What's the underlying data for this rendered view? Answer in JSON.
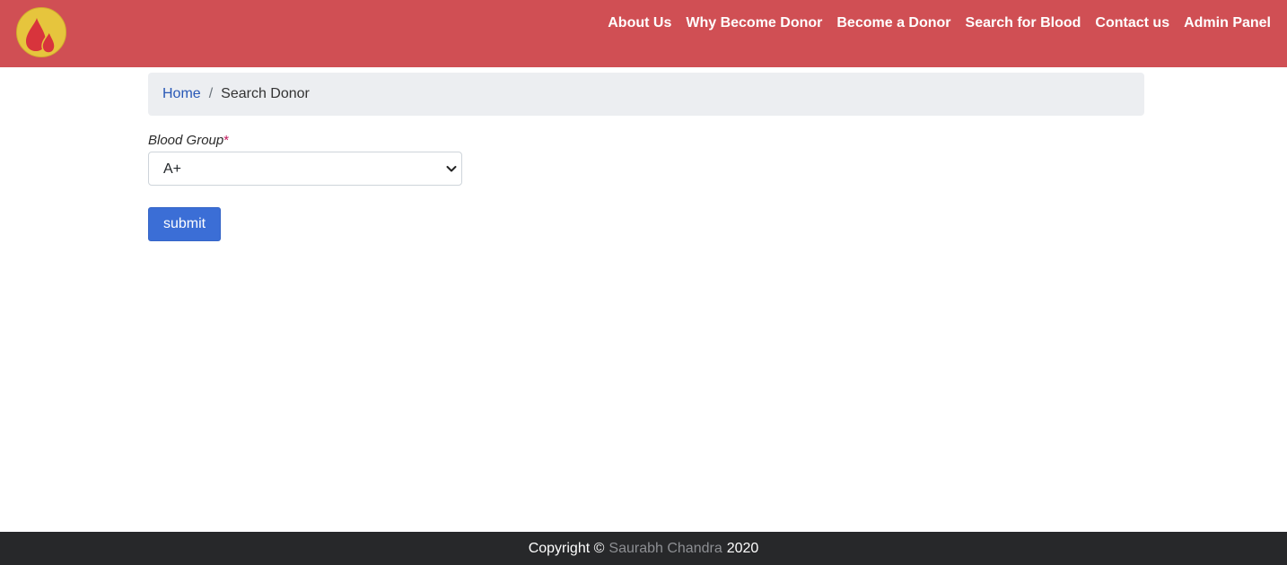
{
  "navbar": {
    "logo_icon": "blood-drops-icon",
    "links": [
      "About Us",
      "Why Become Donor",
      "Become a Donor",
      "Search for Blood",
      "Contact us",
      "Admin Panel"
    ],
    "colors": {
      "background": "#d04f54",
      "logo_circle": "#e6c53d",
      "drops": "#d8343c"
    }
  },
  "breadcrumb": {
    "home": "Home",
    "separator": "/",
    "current": "Search Donor"
  },
  "form": {
    "blood_group_label": "Blood Group",
    "required_marker": "*",
    "blood_group_value": "A+",
    "submit_label": "submit"
  },
  "footer": {
    "copyright_prefix": "Copyright ©",
    "author": "Saurabh Chandra",
    "year": "2020"
  }
}
